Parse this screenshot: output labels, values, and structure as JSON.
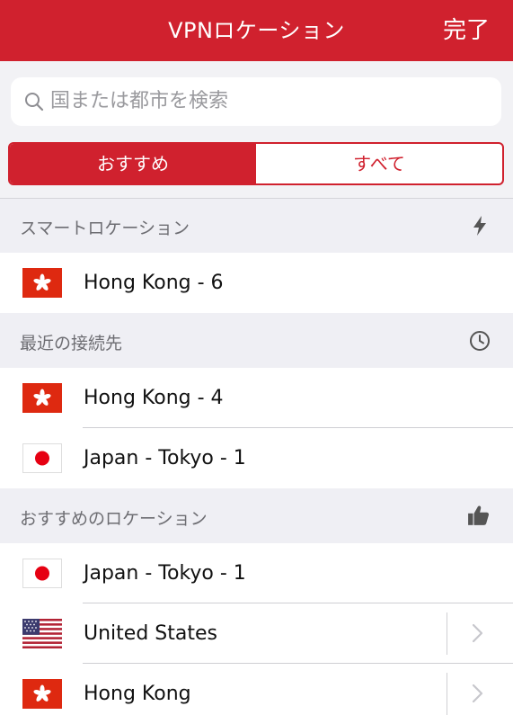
{
  "navbar": {
    "title": "VPNロケーション",
    "done_label": "完了"
  },
  "search": {
    "placeholder": "国または都市を検索"
  },
  "segments": {
    "recommended": "おすすめ",
    "all": "すべて"
  },
  "sections": {
    "smart": {
      "header": "スマートロケーション",
      "icon": "lightning-bolt-icon",
      "rows": [
        {
          "label": "Hong Kong - 6",
          "flag": "hong-kong-flag-icon"
        }
      ]
    },
    "recent": {
      "header": "最近の接続先",
      "icon": "clock-icon",
      "rows": [
        {
          "label": "Hong Kong - 4",
          "flag": "hong-kong-flag-icon"
        },
        {
          "label": "Japan - Tokyo - 1",
          "flag": "japan-flag-icon"
        }
      ]
    },
    "recommended": {
      "header": "おすすめのロケーション",
      "icon": "thumbs-up-icon",
      "rows": [
        {
          "label": "Japan - Tokyo - 1",
          "flag": "japan-flag-icon"
        },
        {
          "label": "United States",
          "flag": "us-flag-icon",
          "has_chevron": true
        },
        {
          "label": "Hong Kong",
          "flag": "hong-kong-flag-icon",
          "has_chevron": true
        }
      ]
    }
  },
  "colors": {
    "brand_red": "#d0212e",
    "background": "#efeff4",
    "secondary_text": "#6d6d72"
  }
}
